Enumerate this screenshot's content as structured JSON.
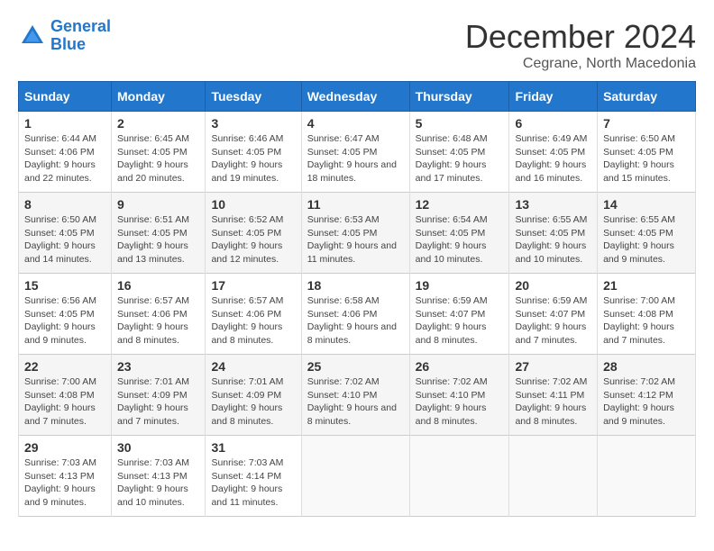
{
  "header": {
    "logo_general": "General",
    "logo_blue": "Blue",
    "month": "December 2024",
    "location": "Cegrane, North Macedonia"
  },
  "days_of_week": [
    "Sunday",
    "Monday",
    "Tuesday",
    "Wednesday",
    "Thursday",
    "Friday",
    "Saturday"
  ],
  "weeks": [
    [
      {
        "day": "1",
        "sunrise": "6:44 AM",
        "sunset": "4:06 PM",
        "daylight": "9 hours and 22 minutes."
      },
      {
        "day": "2",
        "sunrise": "6:45 AM",
        "sunset": "4:05 PM",
        "daylight": "9 hours and 20 minutes."
      },
      {
        "day": "3",
        "sunrise": "6:46 AM",
        "sunset": "4:05 PM",
        "daylight": "9 hours and 19 minutes."
      },
      {
        "day": "4",
        "sunrise": "6:47 AM",
        "sunset": "4:05 PM",
        "daylight": "9 hours and 18 minutes."
      },
      {
        "day": "5",
        "sunrise": "6:48 AM",
        "sunset": "4:05 PM",
        "daylight": "9 hours and 17 minutes."
      },
      {
        "day": "6",
        "sunrise": "6:49 AM",
        "sunset": "4:05 PM",
        "daylight": "9 hours and 16 minutes."
      },
      {
        "day": "7",
        "sunrise": "6:50 AM",
        "sunset": "4:05 PM",
        "daylight": "9 hours and 15 minutes."
      }
    ],
    [
      {
        "day": "8",
        "sunrise": "6:50 AM",
        "sunset": "4:05 PM",
        "daylight": "9 hours and 14 minutes."
      },
      {
        "day": "9",
        "sunrise": "6:51 AM",
        "sunset": "4:05 PM",
        "daylight": "9 hours and 13 minutes."
      },
      {
        "day": "10",
        "sunrise": "6:52 AM",
        "sunset": "4:05 PM",
        "daylight": "9 hours and 12 minutes."
      },
      {
        "day": "11",
        "sunrise": "6:53 AM",
        "sunset": "4:05 PM",
        "daylight": "9 hours and 11 minutes."
      },
      {
        "day": "12",
        "sunrise": "6:54 AM",
        "sunset": "4:05 PM",
        "daylight": "9 hours and 10 minutes."
      },
      {
        "day": "13",
        "sunrise": "6:55 AM",
        "sunset": "4:05 PM",
        "daylight": "9 hours and 10 minutes."
      },
      {
        "day": "14",
        "sunrise": "6:55 AM",
        "sunset": "4:05 PM",
        "daylight": "9 hours and 9 minutes."
      }
    ],
    [
      {
        "day": "15",
        "sunrise": "6:56 AM",
        "sunset": "4:05 PM",
        "daylight": "9 hours and 9 minutes."
      },
      {
        "day": "16",
        "sunrise": "6:57 AM",
        "sunset": "4:06 PM",
        "daylight": "9 hours and 8 minutes."
      },
      {
        "day": "17",
        "sunrise": "6:57 AM",
        "sunset": "4:06 PM",
        "daylight": "9 hours and 8 minutes."
      },
      {
        "day": "18",
        "sunrise": "6:58 AM",
        "sunset": "4:06 PM",
        "daylight": "9 hours and 8 minutes."
      },
      {
        "day": "19",
        "sunrise": "6:59 AM",
        "sunset": "4:07 PM",
        "daylight": "9 hours and 8 minutes."
      },
      {
        "day": "20",
        "sunrise": "6:59 AM",
        "sunset": "4:07 PM",
        "daylight": "9 hours and 7 minutes."
      },
      {
        "day": "21",
        "sunrise": "7:00 AM",
        "sunset": "4:08 PM",
        "daylight": "9 hours and 7 minutes."
      }
    ],
    [
      {
        "day": "22",
        "sunrise": "7:00 AM",
        "sunset": "4:08 PM",
        "daylight": "9 hours and 7 minutes."
      },
      {
        "day": "23",
        "sunrise": "7:01 AM",
        "sunset": "4:09 PM",
        "daylight": "9 hours and 7 minutes."
      },
      {
        "day": "24",
        "sunrise": "7:01 AM",
        "sunset": "4:09 PM",
        "daylight": "9 hours and 8 minutes."
      },
      {
        "day": "25",
        "sunrise": "7:02 AM",
        "sunset": "4:10 PM",
        "daylight": "9 hours and 8 minutes."
      },
      {
        "day": "26",
        "sunrise": "7:02 AM",
        "sunset": "4:10 PM",
        "daylight": "9 hours and 8 minutes."
      },
      {
        "day": "27",
        "sunrise": "7:02 AM",
        "sunset": "4:11 PM",
        "daylight": "9 hours and 8 minutes."
      },
      {
        "day": "28",
        "sunrise": "7:02 AM",
        "sunset": "4:12 PM",
        "daylight": "9 hours and 9 minutes."
      }
    ],
    [
      {
        "day": "29",
        "sunrise": "7:03 AM",
        "sunset": "4:13 PM",
        "daylight": "9 hours and 9 minutes."
      },
      {
        "day": "30",
        "sunrise": "7:03 AM",
        "sunset": "4:13 PM",
        "daylight": "9 hours and 10 minutes."
      },
      {
        "day": "31",
        "sunrise": "7:03 AM",
        "sunset": "4:14 PM",
        "daylight": "9 hours and 11 minutes."
      },
      null,
      null,
      null,
      null
    ]
  ]
}
